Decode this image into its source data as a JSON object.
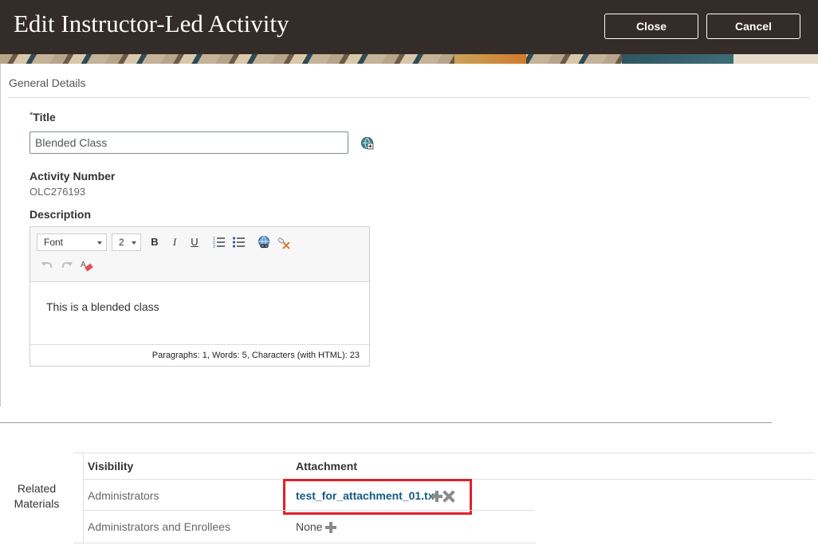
{
  "header": {
    "title": "Edit Instructor-Led Activity",
    "close_label": "Close",
    "cancel_label": "Cancel"
  },
  "general_details": {
    "section_title": "General Details",
    "title_required_marker": "*",
    "title_label": "Title",
    "title_value": "Blended Class",
    "activity_number_label": "Activity Number",
    "activity_number_value": "OLC276193",
    "description_label": "Description"
  },
  "editor": {
    "font_select": "Font",
    "size_select": "2",
    "bold": "B",
    "italic": "I",
    "underline": "U",
    "content": "This is a blended class",
    "status": "Paragraphs: 1, Words: 5, Characters (with HTML): 23"
  },
  "related_materials": {
    "label": "Related Materials",
    "columns": [
      "Visibility",
      "Attachment"
    ],
    "rows": [
      {
        "visibility": "Administrators",
        "attachment": "test_for_attachment_01.txt"
      },
      {
        "visibility": "Administrators and Enrollees",
        "attachment": "None"
      }
    ]
  },
  "colors": {
    "header_bg": "#332c28",
    "link": "#145c82",
    "highlight": "#e0202a"
  }
}
